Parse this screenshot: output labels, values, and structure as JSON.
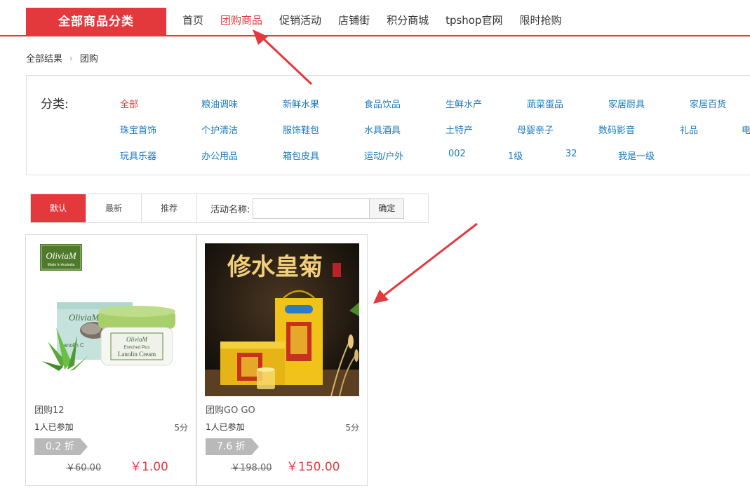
{
  "header": {
    "all_categories": "全部商品分类",
    "nav": [
      "首页",
      "团购商品",
      "促销活动",
      "店铺街",
      "积分商城",
      "tpshop官网",
      "限时抢购"
    ],
    "active_index": 1
  },
  "breadcrumb": {
    "root": "全部结果",
    "separator": ">",
    "current": "团购"
  },
  "categories": {
    "label": "分类:",
    "rows": [
      [
        "全部",
        "粮油调味",
        "新鲜水果",
        "食品饮品",
        "生鲜水产",
        "蔬菜蛋品",
        "家居厨具",
        "家居百货"
      ],
      [
        "珠宝首饰",
        "个护清洁",
        "服饰鞋包",
        "水具酒具",
        "土特产",
        "母婴亲子",
        "数码影音",
        "礼品",
        "电"
      ],
      [
        "玩具乐器",
        "办公用品",
        "箱包皮具",
        "运动/户外",
        "002",
        "1级",
        "32",
        "我是一级"
      ]
    ]
  },
  "filter": {
    "tabs": [
      "默认",
      "最新",
      "推荐"
    ],
    "activity_label": "活动名称:",
    "input_value": "",
    "confirm": "确定"
  },
  "products": [
    {
      "name": "团购12",
      "joined": "1人已参加",
      "score": "5分",
      "discount": "0.2 折",
      "old_price": "￥60.00",
      "new_price": "￥1.00",
      "brand_logo": "OliviaM",
      "brand_sub": "Made In Australia",
      "jar_brand": "OliviaM",
      "jar_line1": "Enriched Plus",
      "jar_line2": "Lanolin Cream",
      "box_text": "Lanolin C"
    },
    {
      "name": "团购GO GO",
      "joined": "1人已参加",
      "score": "5分",
      "discount": "7.6 折",
      "old_price": "￥198.00",
      "new_price": "￥150.00",
      "image_title": "修水皇菊"
    }
  ],
  "colors": {
    "accent": "#e4393c",
    "link": "#1a7bbf",
    "discount_tag": "#b9b9b9"
  }
}
